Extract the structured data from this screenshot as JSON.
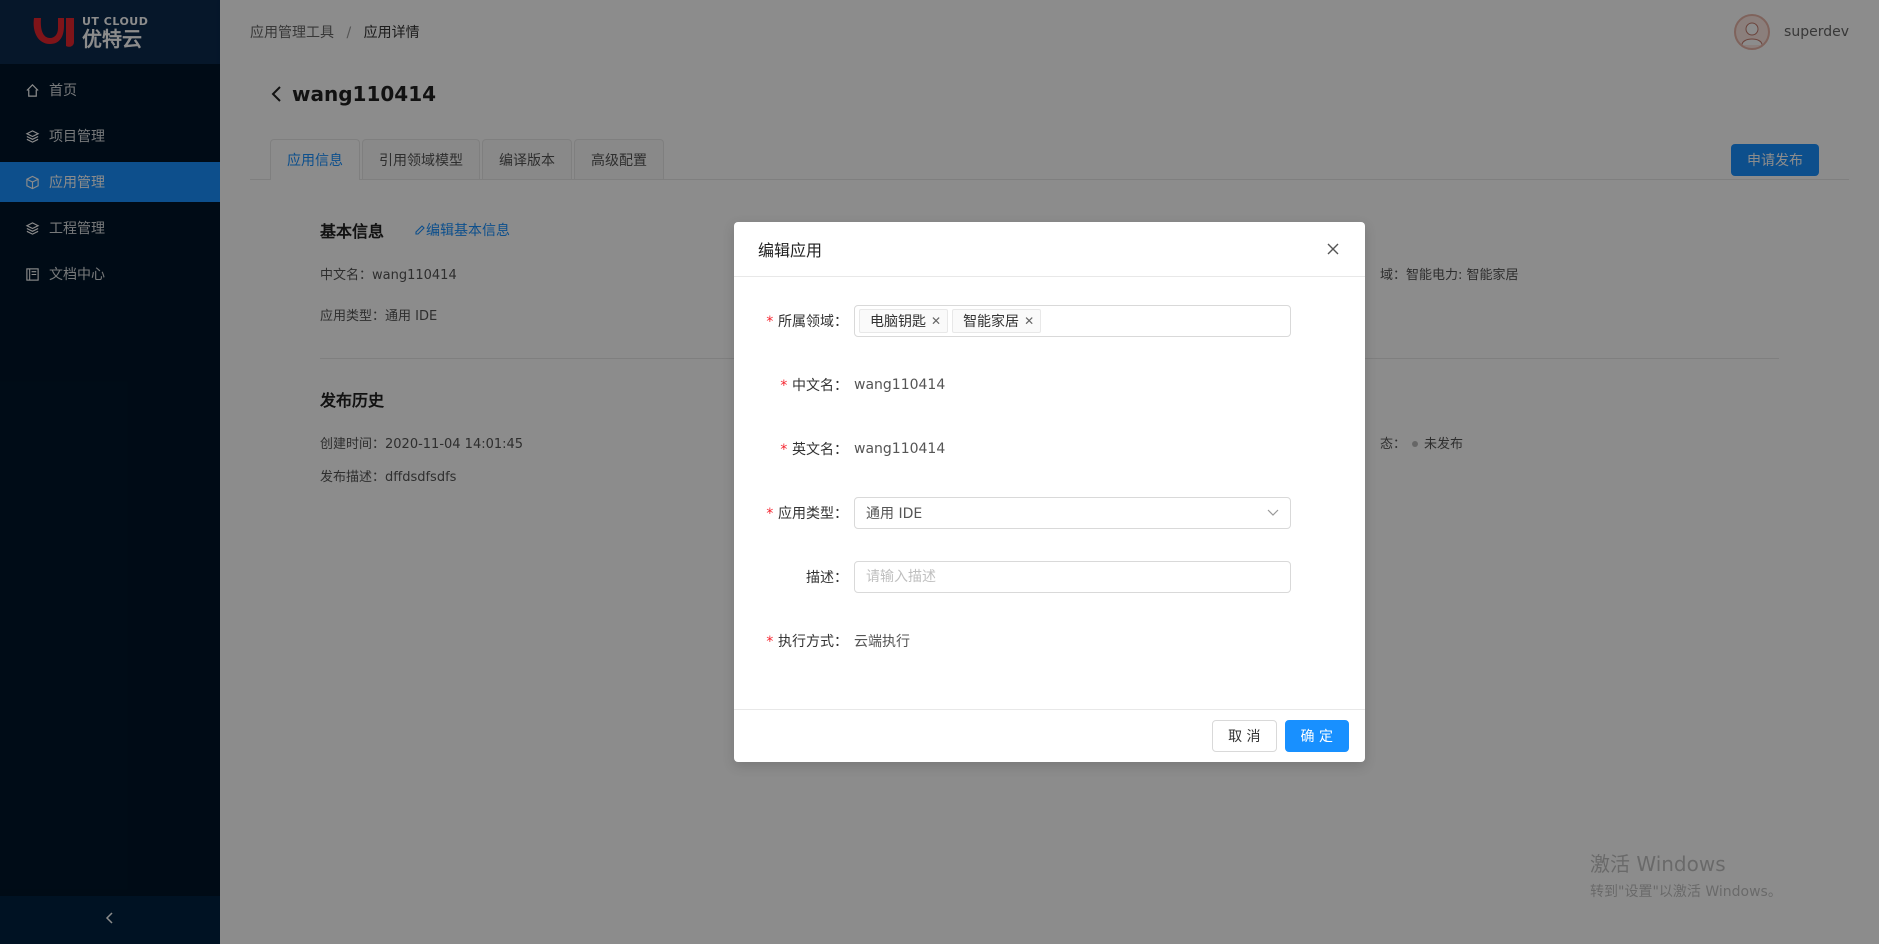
{
  "app": {
    "logo_en": "UT CLOUD",
    "logo_cn": "优特云"
  },
  "sidebar": {
    "items": [
      {
        "label": "首页",
        "icon": "home-icon"
      },
      {
        "label": "项目管理",
        "icon": "layers-icon"
      },
      {
        "label": "应用管理",
        "icon": "cube-icon",
        "active": true
      },
      {
        "label": "工程管理",
        "icon": "layers-icon"
      },
      {
        "label": "文档中心",
        "icon": "book-icon"
      }
    ],
    "collapse_icon": "chevron-left-icon"
  },
  "header": {
    "breadcrumb": [
      "应用管理工具",
      "应用详情"
    ],
    "separator": "/",
    "username": "superdev"
  },
  "page": {
    "title": "wang110414",
    "tabs": [
      {
        "label": "应用信息",
        "active": true
      },
      {
        "label": "引用领域模型"
      },
      {
        "label": "编译版本"
      },
      {
        "label": "高级配置"
      }
    ],
    "publish_button": "申请发布",
    "basic_info": {
      "title": "基本信息",
      "edit_link": "编辑基本信息",
      "cn_name": "中文名：wang110414",
      "app_type": "应用类型：通用 IDE",
      "domain_right": "域：智能电力: 智能家居"
    },
    "history": {
      "title": "发布历史",
      "created": "创建时间：2020-11-04 14:01:45",
      "desc": "发布描述：dffdsdfsdfs",
      "status_prefix": "态：",
      "status": "未发布"
    }
  },
  "modal": {
    "title": "编辑应用",
    "fields": {
      "domain": {
        "label": "所属领域：",
        "tags": [
          "电脑钥匙",
          "智能家居"
        ]
      },
      "cn_name": {
        "label": "中文名：",
        "value": "wang110414"
      },
      "en_name": {
        "label": "英文名：",
        "value": "wang110414"
      },
      "app_type": {
        "label": "应用类型：",
        "value": "通用 IDE"
      },
      "desc": {
        "label": "描述：",
        "placeholder": "请输入描述"
      },
      "exec": {
        "label": "执行方式：",
        "value": "云端执行"
      }
    },
    "cancel": "取 消",
    "confirm": "确 定"
  },
  "watermark": {
    "line1": "激活 Windows",
    "line2": "转到\"设置\"以激活 Windows。"
  },
  "colors": {
    "primary": "#1890ff",
    "sidebar_bg": "#001529",
    "required": "#f5222d"
  }
}
